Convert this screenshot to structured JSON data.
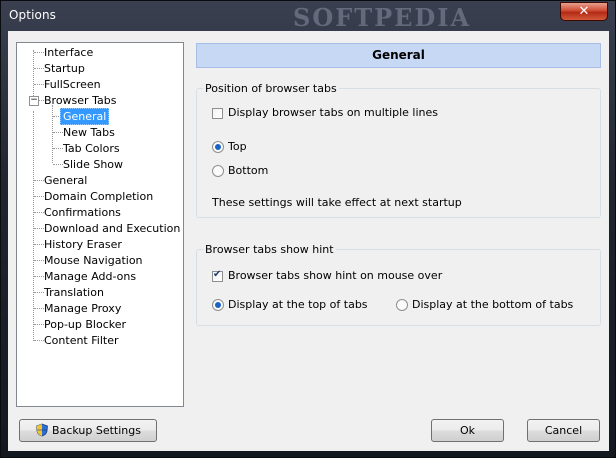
{
  "window": {
    "title": "Options",
    "watermark": "SOFTPEDIA",
    "close_glyph": "✕"
  },
  "tree": {
    "items": [
      {
        "label": "Interface"
      },
      {
        "label": "Startup"
      },
      {
        "label": "FullScreen"
      },
      {
        "label": "Browser Tabs",
        "expander": "−"
      },
      {
        "label": "General"
      },
      {
        "label": "New Tabs"
      },
      {
        "label": "Tab Colors"
      },
      {
        "label": "Slide Show"
      },
      {
        "label": "General"
      },
      {
        "label": "Domain Completion"
      },
      {
        "label": "Confirmations"
      },
      {
        "label": "Download and Execution"
      },
      {
        "label": "History Eraser"
      },
      {
        "label": "Mouse Navigation"
      },
      {
        "label": "Manage Add-ons"
      },
      {
        "label": "Translation"
      },
      {
        "label": "Manage Proxy"
      },
      {
        "label": "Pop-up Blocker"
      },
      {
        "label": "Content Filter"
      }
    ]
  },
  "panel": {
    "header": "General",
    "group1": {
      "title": "Position of browser tabs",
      "multiline_label": "Display browser tabs on multiple lines",
      "multiline_checked": false,
      "top_label": "Top",
      "bottom_label": "Bottom",
      "selected": "Top",
      "note": "These settings will take effect at next startup"
    },
    "group2": {
      "title": "Browser tabs show hint",
      "hint_label": "Browser tabs show hint on mouse over",
      "hint_checked": true,
      "top_tabs_label": "Display at the top of tabs",
      "bottom_tabs_label": "Display at the bottom of tabs",
      "selected": "Display at the top of tabs"
    }
  },
  "buttons": {
    "backup": "Backup Settings",
    "backup_icon": "shield-icon",
    "ok": "Ok",
    "cancel": "Cancel"
  }
}
